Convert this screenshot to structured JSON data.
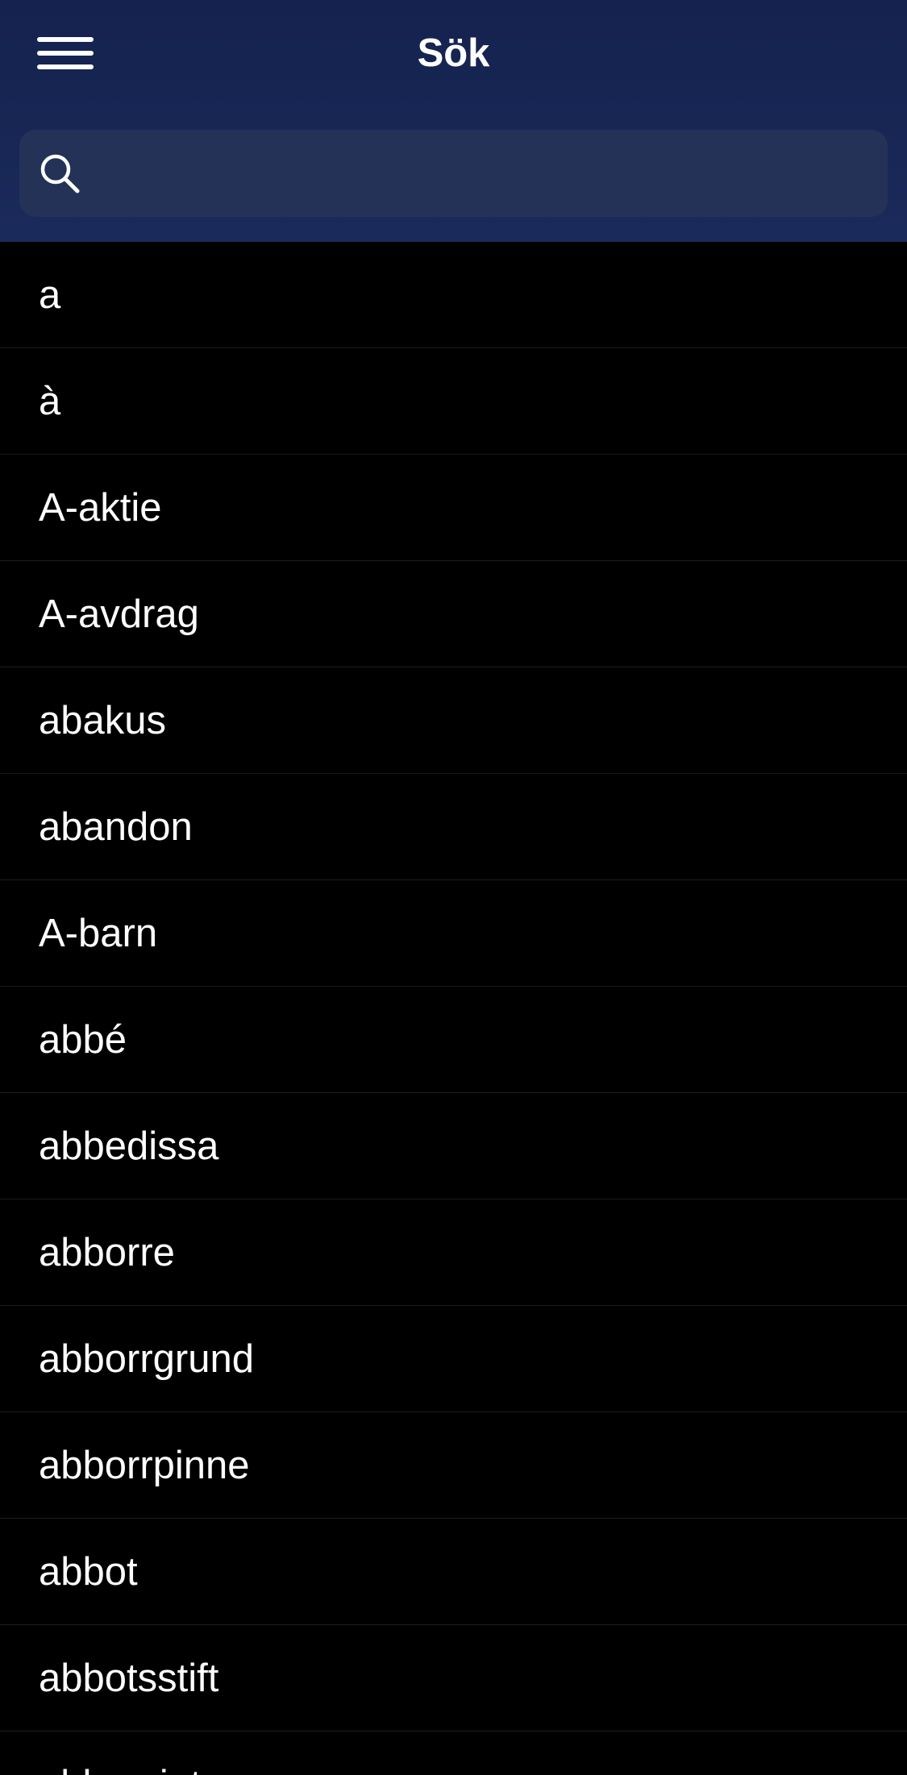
{
  "header": {
    "title": "Sök",
    "menu_icon": "hamburger-menu-icon",
    "background_color": "#15224f"
  },
  "search": {
    "icon": "search-icon",
    "placeholder": "",
    "value": ""
  },
  "word_list": {
    "items": [
      "a",
      "à",
      "A-aktie",
      "A-avdrag",
      "abakus",
      "abandon",
      "A-barn",
      "abbé",
      "abbedissa",
      "abborre",
      "abborrgrund",
      "abborrpinne",
      "abbot",
      "abbotsstift",
      "abbreviatur"
    ]
  }
}
